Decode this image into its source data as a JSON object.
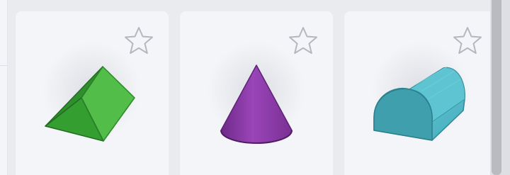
{
  "shapes_panel": {
    "cards": [
      {
        "shape": "wedge",
        "icon": "green-wedge-icon",
        "color": "#3fae3c",
        "favorite_icon": "star-outline-icon"
      },
      {
        "shape": "cone",
        "icon": "purple-cone-icon",
        "color": "#8a3aa3",
        "favorite_icon": "star-outline-icon"
      },
      {
        "shape": "half-cylinder",
        "icon": "teal-half-cylinder-icon",
        "color": "#4db7c6",
        "favorite_icon": "star-outline-icon"
      }
    ],
    "star_color": "#b4b7bd",
    "scrollbar_color": "#b9bbc0"
  }
}
